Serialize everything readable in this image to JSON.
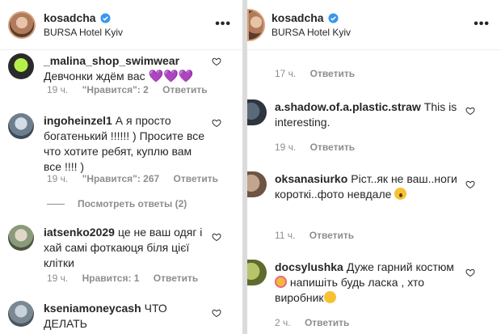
{
  "left": {
    "header": {
      "username": "kosadcha",
      "location": "BURSA Hotel Kyiv",
      "more": "•••"
    },
    "comments": [
      {
        "username": "_malina_shop_swimwear",
        "text": "Девчонки ждём вас ",
        "emoji": "💜💜💜",
        "time": "19 ч.",
        "likes": "\"Нравится\": 2",
        "reply": "Ответить"
      },
      {
        "username": "ingoheinzel1",
        "text": "А я просто богатенький !!!!!! ) Просите все что хотите ребят, куплю вам все !!!! )",
        "time": "19 ч.",
        "likes": "\"Нравится\": 267",
        "reply": "Ответить",
        "view_replies": "Посмотреть ответы (2)"
      },
      {
        "username": "iatsenko2029",
        "text": "це не ваш одяг і хай самі фоткаюця біля цієї клітки",
        "time": "19 ч.",
        "likes": "Нравится: 1",
        "reply": "Ответить"
      },
      {
        "username": "kseniamoneycash",
        "text": "ЧТО ДЕЛАТЬ"
      }
    ]
  },
  "right": {
    "header": {
      "username": "kosadcha",
      "location": "BURSA Hotel Kyiv",
      "more": "•••"
    },
    "top_meta": {
      "time": "17 ч.",
      "reply": "Ответить"
    },
    "comments": [
      {
        "username": "a.shadow.of.a.plastic.straw",
        "text": "This is interesting.",
        "time": "19 ч.",
        "reply": "Ответить"
      },
      {
        "username": "oksanasiurko",
        "text": "Ріст..як не ваш..ноги короткі..фото невдале",
        "time": "11 ч.",
        "reply": "Ответить"
      },
      {
        "username": "docsylushka",
        "text1": "Дуже гарний костюм",
        "text2": " напишіть будь ласка , хто виробник",
        "time": "2 ч.",
        "reply": "Ответить"
      }
    ]
  }
}
